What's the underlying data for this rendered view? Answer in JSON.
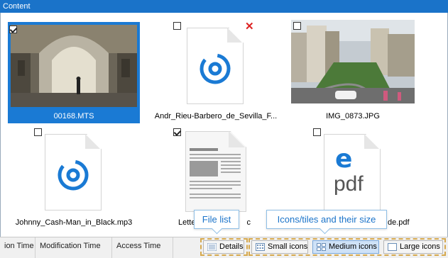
{
  "panel": {
    "title": "Content"
  },
  "files": [
    {
      "name": "00168.MTS",
      "type": "video",
      "checked": true,
      "selected": true
    },
    {
      "name": "Andr_Rieu-Barbero_de_Sevilla_F...",
      "type": "audio",
      "checked": false,
      "selected": false,
      "remove_icon": "close-icon"
    },
    {
      "name": "IMG_0873.JPG",
      "type": "image",
      "checked": false,
      "selected": false
    },
    {
      "name": "Johnny_Cash-Man_in_Black.mp3",
      "type": "audio",
      "checked": false,
      "selected": false
    },
    {
      "name": "Lette",
      "name_tail": "c",
      "type": "document",
      "checked": true,
      "selected": false
    },
    {
      "name_tail": "de.pdf",
      "type": "pdf",
      "pdf_label": "pdf",
      "checked": false,
      "selected": false
    }
  ],
  "columns": [
    "ion Time",
    "Modification Time",
    "Access Time"
  ],
  "view_buttons": [
    {
      "label": "Details",
      "icon": "details-icon",
      "active": false
    },
    {
      "label": "Small icons",
      "icon": "small-icons-icon",
      "active": false
    },
    {
      "label": "Medium icons",
      "icon": "medium-icons-icon",
      "active": true
    },
    {
      "label": "Large icons",
      "icon": "large-icons-icon",
      "active": false
    }
  ],
  "tooltips": {
    "file_list": "File list",
    "icons_tiles": "Icons/tiles and their size"
  },
  "colors": {
    "accent": "#1a7ad4",
    "tooltip_border": "#8fbfe6",
    "highlight_dash": "#d6a94e",
    "close": "#dd2222"
  }
}
